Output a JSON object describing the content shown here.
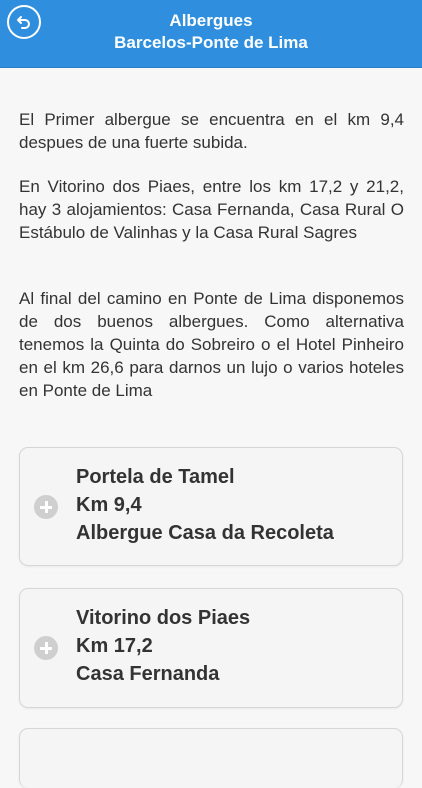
{
  "header": {
    "title_line1": "Albergues",
    "title_line2": "Barcelos-Ponte de Lima",
    "back_icon": "back-arrow-icon"
  },
  "paragraphs": [
    "El Primer albergue se encuentra en el km 9,4 despues de una fuerte subida.",
    "En Vitorino dos Piaes, entre los km 17,2 y 21,2, hay 3 alojamientos: Casa Fernanda, Casa Rural O Estábulo de Valinhas y la Casa Rural Sagres",
    "Al final del camino en Ponte de Lima disponemos de dos buenos albergues. Como alternativa tenemos la Quinta do Sobreiro o el Hotel Pinheiro en el km 26,6 para darnos un lujo o varios hoteles en Ponte de Lima"
  ],
  "cards": [
    {
      "place": "Portela de Tamel",
      "km": "Km 9,4",
      "name": "Albergue Casa da Recoleta",
      "icon": "plus-circle-icon"
    },
    {
      "place": "Vitorino dos Piaes",
      "km": "Km 17,2",
      "name": "Casa Fernanda",
      "icon": "plus-circle-icon"
    }
  ],
  "colors": {
    "header_bg": "#2f8fde",
    "text": "#333333",
    "card_bg": "#f5f5f5"
  }
}
